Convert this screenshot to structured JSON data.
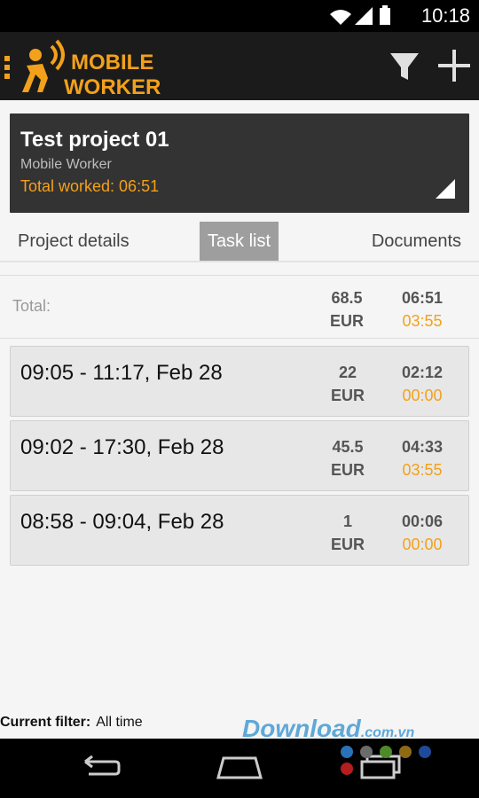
{
  "status_bar": {
    "time": "10:18",
    "icons": [
      "wifi-icon",
      "signal-icon",
      "battery-icon"
    ]
  },
  "app_bar": {
    "logo_text": [
      "MOBILE",
      "WORKER"
    ],
    "brand_color": "#f3a11a"
  },
  "project": {
    "title": "Test project 01",
    "subtitle": "Mobile Worker",
    "total_worked": "Total worked: 06:51"
  },
  "tabs": [
    {
      "label": "Project details"
    },
    {
      "label": "Task list",
      "active": true
    },
    {
      "label": "Documents"
    }
  ],
  "summary": {
    "label": "Total:",
    "amount": "68.5",
    "currency": "EUR",
    "time_total": "06:51",
    "time_secondary": "03:55"
  },
  "tasks": [
    {
      "range": "09:05 - 11:17, Feb 28",
      "amount": "22",
      "currency": "EUR",
      "time_total": "02:12",
      "time_secondary": "00:00"
    },
    {
      "range": "09:02 - 17:30, Feb 28",
      "amount": "45.5",
      "currency": "EUR",
      "time_total": "04:33",
      "time_secondary": "03:55"
    },
    {
      "range": "08:58 - 09:04, Feb 28",
      "amount": "1",
      "currency": "EUR",
      "time_total": "00:06",
      "time_secondary": "00:00"
    }
  ],
  "footer": {
    "filter_label": "Current filter:",
    "filter_value": "All time"
  },
  "watermark": {
    "main": "Download",
    "suffix": ".com.vn"
  },
  "nav": {
    "buttons": [
      "back-icon",
      "home-icon",
      "recents-icon"
    ]
  }
}
